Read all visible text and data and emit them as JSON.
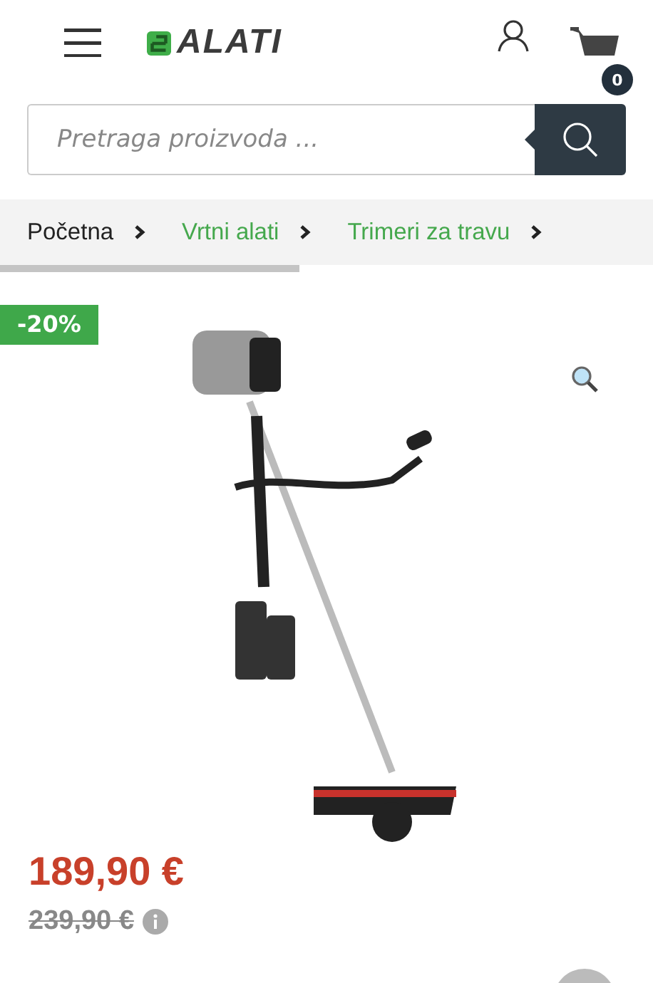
{
  "header": {
    "logo": "ALATI",
    "cart_count": "0"
  },
  "search": {
    "placeholder": "Pretraga proizvoda ..."
  },
  "breadcrumb": [
    {
      "label": "Početna",
      "kind": "home"
    },
    {
      "label": "Vrtni alati",
      "kind": "link"
    },
    {
      "label": "Trimeri za travu",
      "kind": "link"
    }
  ],
  "product": {
    "discount_badge": "-20%",
    "price": "189,90 €",
    "old_price": "239,90 €"
  }
}
